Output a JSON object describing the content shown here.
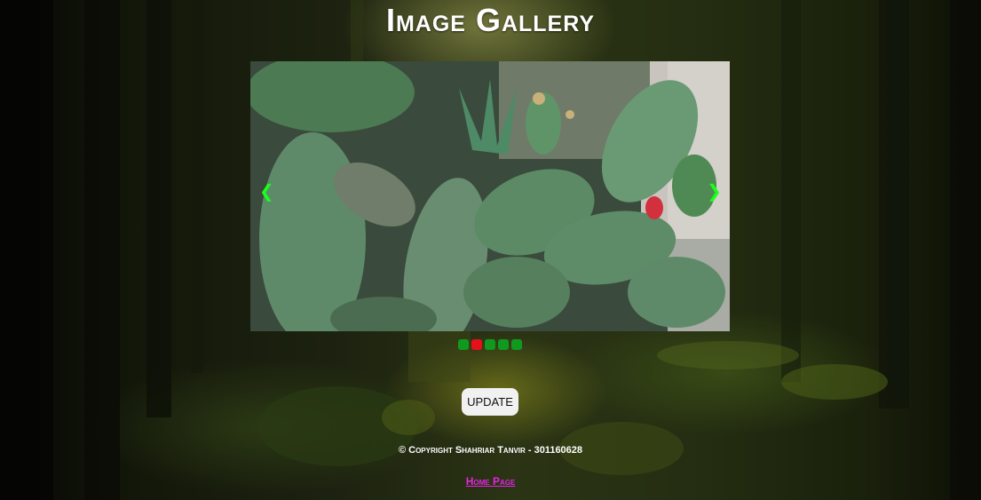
{
  "page": {
    "title": "Image Gallery"
  },
  "gallery": {
    "prev_icon": "chevron-left-icon",
    "next_icon": "chevron-right-icon",
    "prev_glyph": "❮",
    "next_glyph": "❯",
    "slide_count": 5,
    "active_index": 1,
    "dot_color": "#0f9a1f",
    "active_dot_color": "#e4111a",
    "arrow_color": "#19ff19"
  },
  "update_button": {
    "label": "UPDATE"
  },
  "footer": {
    "copyright": "© Copyright Shahriar Tanvir - 301160628",
    "home_link": "Home Page",
    "home_link_color": "#e623e6"
  }
}
